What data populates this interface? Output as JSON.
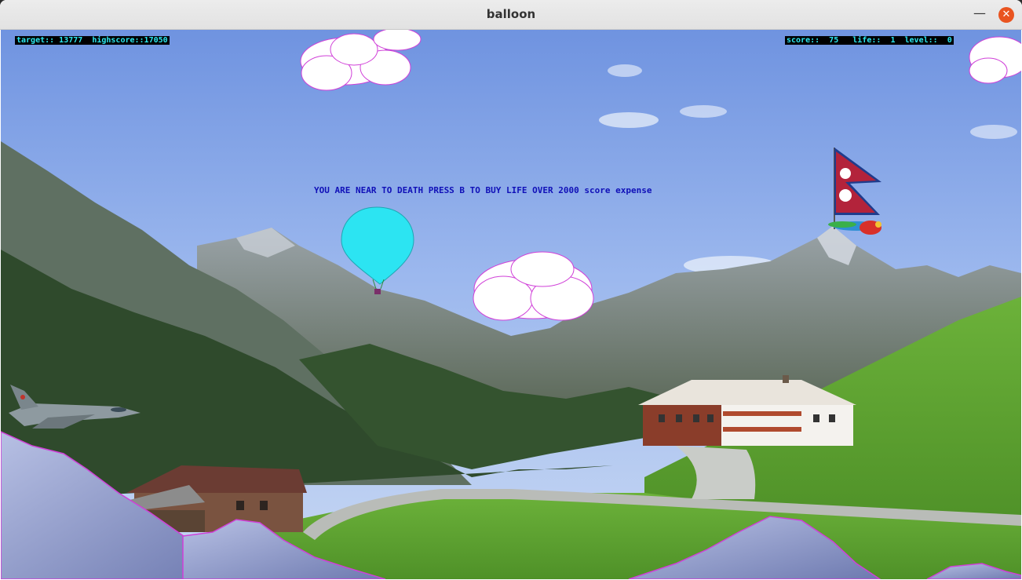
{
  "window": {
    "title": "balloon",
    "minimize_icon": "minimize-icon",
    "close_icon": "close-icon"
  },
  "hud": {
    "left_text": "target:: 13777  highscore::17050",
    "right_text": "score::  75   life::  1  level::  0"
  },
  "message": "YOU ARE NEAR TO DEATH PRESS B TO BUY LIFE OVER 2000 score expense",
  "colors": {
    "balloon": "#2ce4f2",
    "hud_text": "#2be8f0",
    "message_text": "#1010b8",
    "close_button": "#e95420"
  }
}
